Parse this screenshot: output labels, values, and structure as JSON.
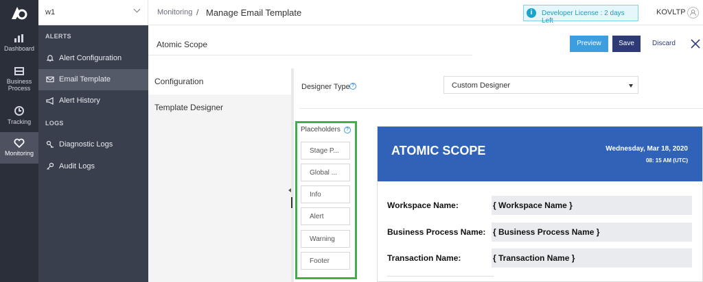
{
  "rail": {
    "items": [
      {
        "label": "Dashboard",
        "icon": "dashboard-icon"
      },
      {
        "label": "Business Process",
        "icon": "business-process-icon"
      },
      {
        "label": "Tracking",
        "icon": "tracking-icon"
      },
      {
        "label": "Monitoring",
        "icon": "monitoring-icon"
      }
    ]
  },
  "workspace": {
    "name": "w1"
  },
  "menu": {
    "alerts_heading": "ALERTS",
    "logs_heading": "LOGS",
    "items": [
      {
        "label": "Alert Configuration",
        "icon": "bell-icon"
      },
      {
        "label": "Email Template",
        "icon": "envelope-icon"
      },
      {
        "label": "Alert History",
        "icon": "megaphone-icon"
      },
      {
        "label": "Diagnostic Logs",
        "icon": "diagnostic-icon"
      },
      {
        "label": "Audit Logs",
        "icon": "key-icon"
      }
    ]
  },
  "header": {
    "breadcrumb_parent": "Monitoring",
    "breadcrumb_sep": "/",
    "page_title": "Manage Email Template",
    "license": "Developer License : 2 days Left",
    "user": "KOVLTP"
  },
  "content": {
    "title": "Atomic Scope",
    "buttons": {
      "preview": "Preview",
      "save": "Save",
      "discard": "Discard"
    },
    "tabs": [
      "Configuration",
      "Template Designer"
    ],
    "designer_type_label": "Designer Type",
    "designer_type_value": "Custom Designer",
    "placeholders_title": "Placeholders",
    "placeholders": [
      "Stage P...",
      "Global ...",
      "Info",
      "Alert",
      "Warning",
      "Footer"
    ]
  },
  "preview": {
    "brand": "ATOMIC SCOPE",
    "date": "Wednesday, Mar 18, 2020",
    "time": "08: 15 AM (UTC)",
    "rows": [
      {
        "label": "Workspace Name:",
        "value": "{ Workspace Name }"
      },
      {
        "label": "Business Process Name:",
        "value": "{ Business Process Name }"
      },
      {
        "label": "Transaction Name:",
        "value": "{ Transaction Name }"
      }
    ]
  },
  "colors": {
    "rail_bg": "#2b2f3a",
    "menu_bg": "#3a3f4d",
    "accent_blue": "#3c9ede",
    "save_navy": "#2e3a75",
    "preview_header": "#3063b8",
    "highlight_green": "#3cb04a"
  }
}
